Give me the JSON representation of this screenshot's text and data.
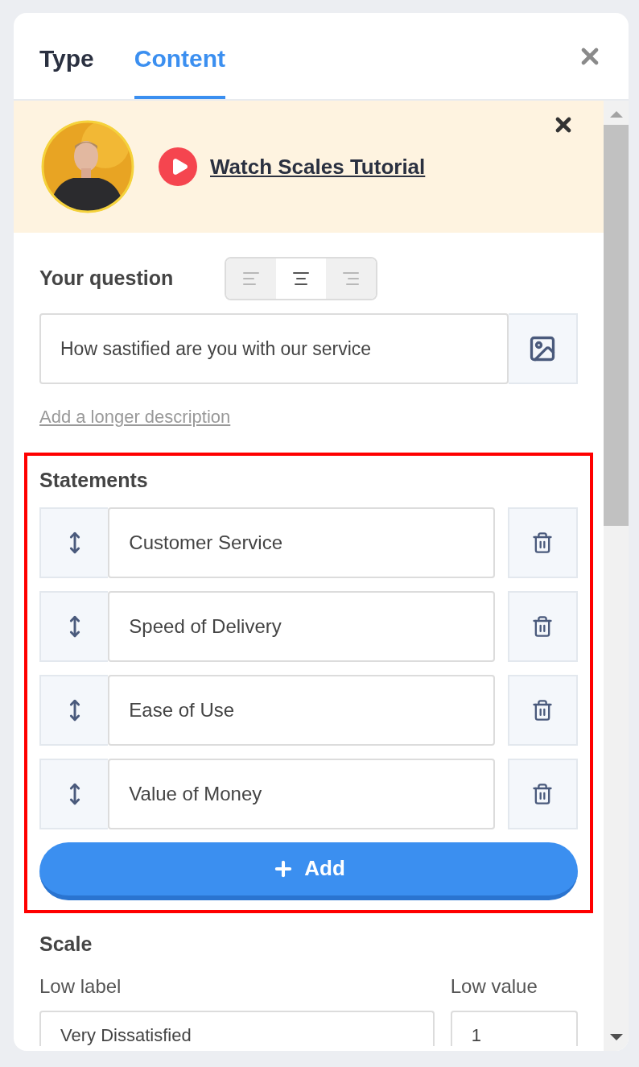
{
  "tabs": [
    {
      "label": "Type",
      "selected": false
    },
    {
      "label": "Content",
      "selected": true
    }
  ],
  "tutorial": {
    "link": "Watch Scales Tutorial"
  },
  "question": {
    "label": "Your question",
    "alignment": [
      {
        "kind": "left",
        "selected": false
      },
      {
        "kind": "center",
        "selected": true
      },
      {
        "kind": "right",
        "selected": false
      }
    ],
    "value": "How sastified are you with our service",
    "description_link": "Add a longer description"
  },
  "statements": {
    "title": "Statements",
    "highlighted": true,
    "items": [
      {
        "value": "Customer Service"
      },
      {
        "value": "Speed of Delivery"
      },
      {
        "value": "Ease of Use"
      },
      {
        "value": "Value of Money"
      }
    ],
    "add_button": "Add"
  },
  "scale": {
    "title": "Scale",
    "low_label": {
      "label": "Low label",
      "value": "Very Dissatisfied"
    },
    "low_value": {
      "label": "Low value",
      "value": "1"
    }
  }
}
